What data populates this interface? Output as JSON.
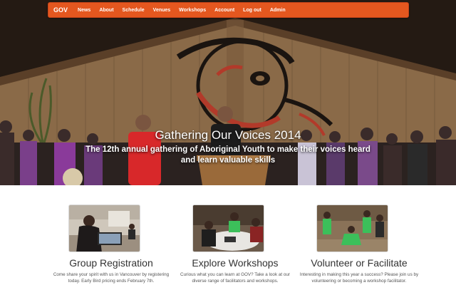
{
  "navbar": {
    "brand": "GOV",
    "items": [
      "News",
      "About",
      "Schedule",
      "Venues",
      "Workshops",
      "Account",
      "Log out",
      "Admin"
    ],
    "background_color": "#e4571f"
  },
  "hero": {
    "title": "Gathering Our Voices 2014",
    "subtitle": "The 12th annual gathering of Aboriginal Youth to make their voices heard and learn valuable skills"
  },
  "features": [
    {
      "heading": "Group Registration",
      "text": "Come share your spirit with us in Vancouver by registering today. Early Bird pricing ends February 7th."
    },
    {
      "heading": "Explore Workshops",
      "text": "Curious what you can learn at GOV? Take a look at our diverse range of facilitators and workshops."
    },
    {
      "heading": "Volunteer or Facilitate",
      "text": "Interesting in making this year a success? Please join us by volunteering or becoming a workshop facilitator."
    }
  ]
}
